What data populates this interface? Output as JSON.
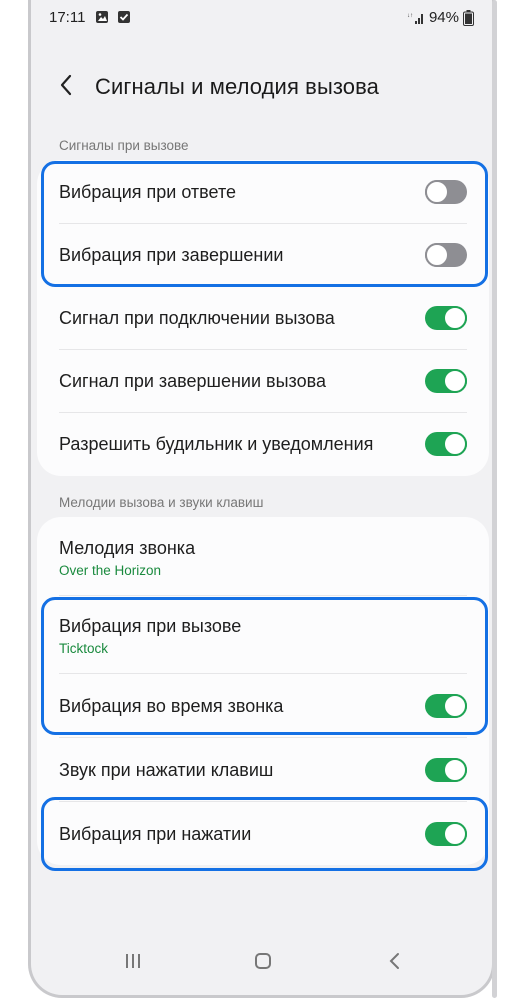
{
  "status_bar": {
    "time": "17:11",
    "battery": "94%"
  },
  "header": {
    "title": "Сигналы и мелодия вызова"
  },
  "section1": {
    "label": "Сигналы при вызове",
    "items": [
      {
        "label": "Вибрация при ответе",
        "toggle": "off"
      },
      {
        "label": "Вибрация при завершении",
        "toggle": "off"
      },
      {
        "label": "Сигнал при подключении вызова",
        "toggle": "on"
      },
      {
        "label": "Сигнал при завершении вызова",
        "toggle": "on"
      },
      {
        "label": "Разрешить будильник и уведомления",
        "toggle": "on"
      }
    ]
  },
  "section2": {
    "label": "Мелодии вызова и звуки клавиш",
    "items": [
      {
        "label": "Мелодия звонка",
        "sub": "Over the Horizon"
      },
      {
        "label": "Вибрация при вызове",
        "sub": "Ticktock"
      },
      {
        "label": "Вибрация во время звонка",
        "toggle": "on"
      },
      {
        "label": "Звук при нажатии клавиш",
        "toggle": "on"
      },
      {
        "label": "Вибрация при нажатии",
        "toggle": "on"
      }
    ]
  },
  "colors": {
    "accent_green": "#1ea454",
    "highlight_blue": "#1470e4",
    "sub_text_green": "#1a8a3e"
  }
}
